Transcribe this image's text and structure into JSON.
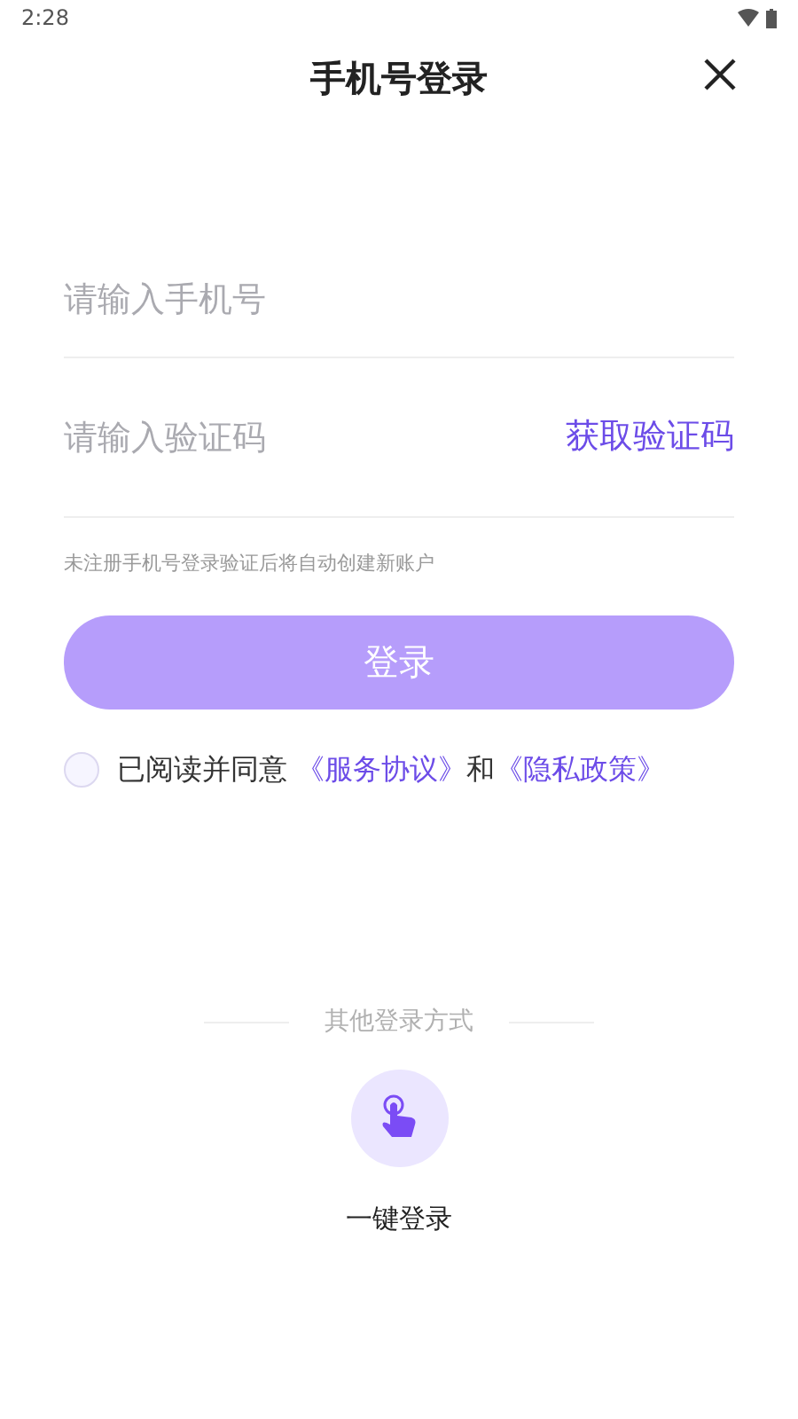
{
  "status_bar": {
    "time": "2:28"
  },
  "header": {
    "title": "手机号登录"
  },
  "phone_field": {
    "placeholder": "请输入手机号"
  },
  "code_field": {
    "placeholder": "请输入验证码",
    "action": "获取验证码"
  },
  "hint": "未注册手机号登录验证后将自动创建新账户",
  "login_button": {
    "label": "登录",
    "disabled": true
  },
  "agreement": {
    "checked": false,
    "text": "已阅读并同意",
    "link_1": "《服务协议》",
    "joiner": "和",
    "link_2": "《隐私政策》"
  },
  "other_methods": {
    "heading": "其他登录方式",
    "items": [
      {
        "label": "一键登录"
      }
    ]
  }
}
